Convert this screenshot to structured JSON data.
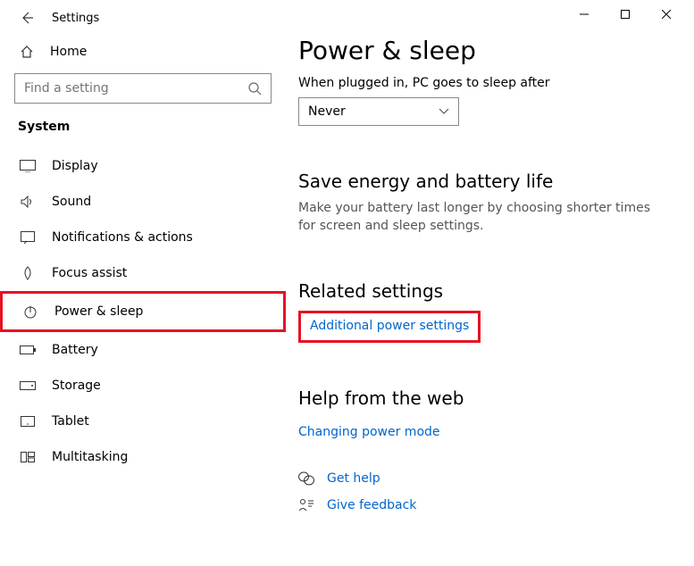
{
  "titlebar": {
    "app": "Settings"
  },
  "sidebar": {
    "home": "Home",
    "search_placeholder": "Find a setting",
    "group": "System",
    "items": [
      {
        "label": "Display"
      },
      {
        "label": "Sound"
      },
      {
        "label": "Notifications & actions"
      },
      {
        "label": "Focus assist"
      },
      {
        "label": "Power & sleep"
      },
      {
        "label": "Battery"
      },
      {
        "label": "Storage"
      },
      {
        "label": "Tablet"
      },
      {
        "label": "Multitasking"
      }
    ]
  },
  "main": {
    "title": "Power & sleep",
    "sleep_label": "When plugged in, PC goes to sleep after",
    "sleep_value": "Never",
    "energy_heading": "Save energy and battery life",
    "energy_body": "Make your battery last longer by choosing shorter times for screen and sleep settings.",
    "related_heading": "Related settings",
    "related_link": "Additional power settings",
    "help_heading": "Help from the web",
    "help_link": "Changing power mode",
    "get_help": "Get help",
    "feedback": "Give feedback"
  }
}
